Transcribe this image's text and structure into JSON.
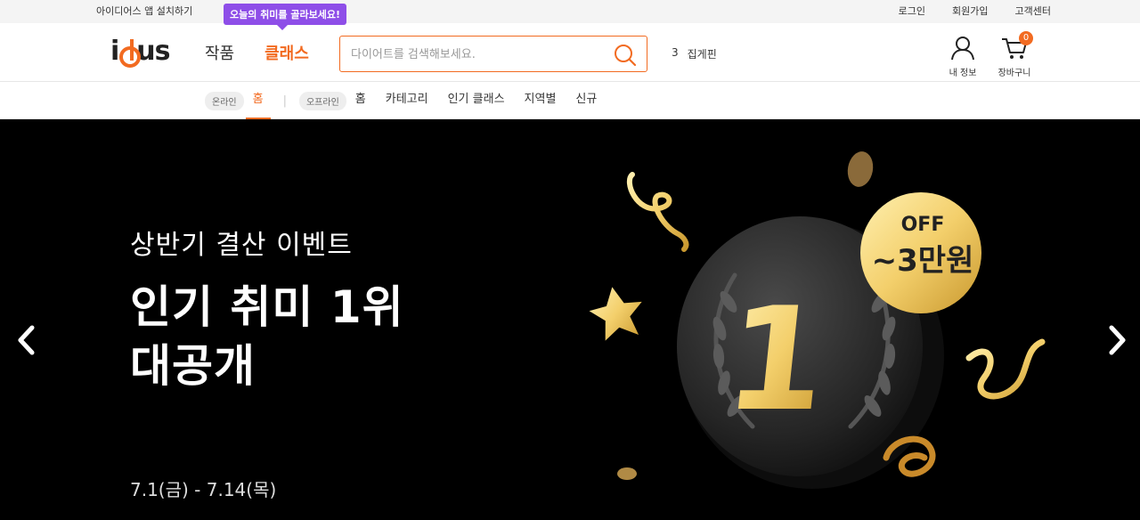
{
  "topbar": {
    "app_install": "아이디어스 앱 설치하기",
    "links": [
      "로그인",
      "회원가입",
      "고객센터"
    ]
  },
  "header": {
    "logo": "idus",
    "tabs": [
      {
        "label": "작품",
        "active": false
      },
      {
        "label": "클래스",
        "active": true
      }
    ],
    "tooltip": "오늘의 취미를 골라보세요!",
    "search": {
      "placeholder": "다이어트를 검색해보세요."
    },
    "pin": {
      "count": "3",
      "label": "집게핀"
    },
    "my_info": "내 정보",
    "cart": {
      "label": "장바구니",
      "count": "0"
    }
  },
  "subnav": {
    "online_pill": "온라인",
    "online_items": [
      {
        "label": "홈",
        "active": true
      }
    ],
    "separator": "|",
    "offline_pill": "오프라인",
    "offline_items": [
      {
        "label": "홈",
        "active": false
      },
      {
        "label": "카테고리",
        "active": false
      },
      {
        "label": "인기 클래스",
        "active": false
      },
      {
        "label": "지역별",
        "active": false
      },
      {
        "label": "신규",
        "active": false
      }
    ]
  },
  "banner": {
    "subtitle": "상반기 결산 이벤트",
    "title_line1": "인기 취미 1위",
    "title_line2": "대공개",
    "period": "7.1(금) - 7.14(목)",
    "badge_off": "OFF",
    "badge_amount": "~3만원",
    "medal_number": "1"
  },
  "colors": {
    "accent": "#f26b21",
    "tooltip": "#8e4ee8",
    "gold": "#f3cf6b"
  }
}
